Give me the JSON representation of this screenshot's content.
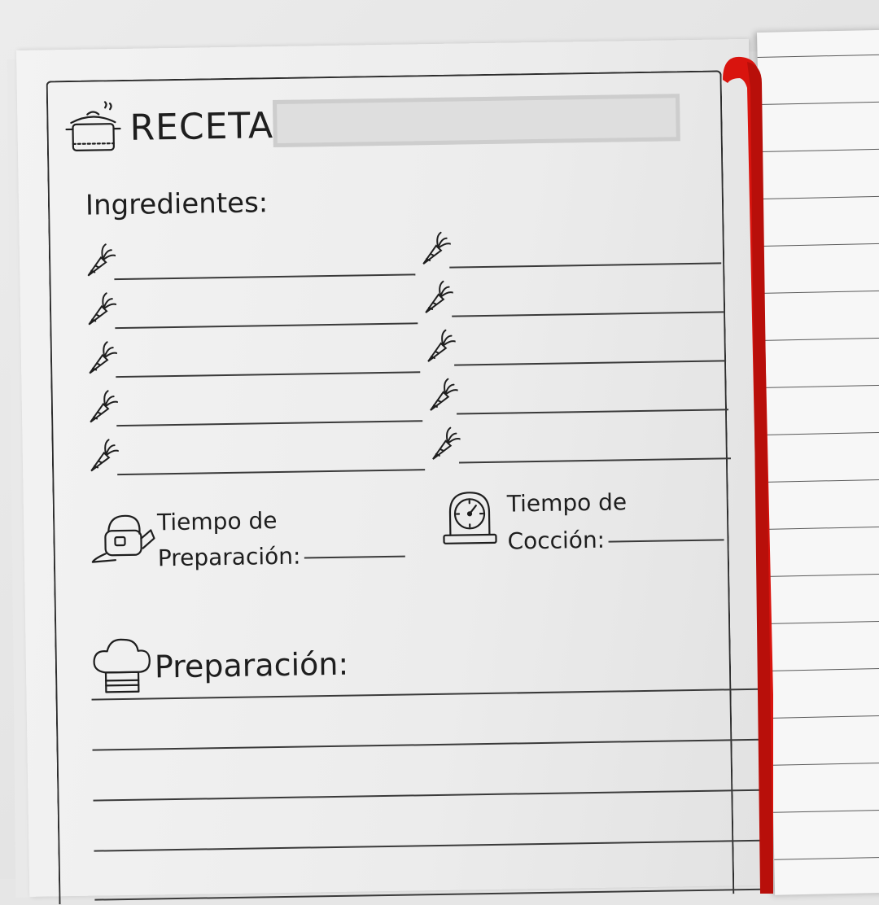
{
  "recipe_page": {
    "title_label": "RECETA:",
    "ingredients_label": "Ingredientes:",
    "ingredient_slots": 10,
    "prep_time_line1": "Tiempo de",
    "prep_time_line2": "Preparación:",
    "cook_time_line1": "Tiempo de",
    "cook_time_line2": "Cocción:",
    "preparation_label": "Preparación:"
  },
  "icons": {
    "title": "cooking-pot-icon",
    "ingredient": "carrot-icon",
    "prep_time": "kettle-icon",
    "cook_time": "clock-icon",
    "preparation": "chef-hat-icon"
  },
  "colors": {
    "ink": "#1e1e1e",
    "page": "#efefef",
    "ribbon": "#d9140e"
  }
}
